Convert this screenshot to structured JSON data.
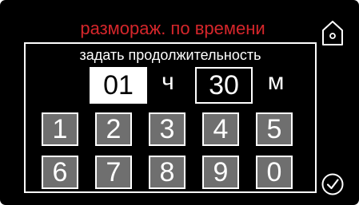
{
  "header": {
    "title": "размораж. по времени",
    "home_icon": "home-icon"
  },
  "panel": {
    "subtitle": "задать продолжительность",
    "hours_value": "01",
    "hours_unit": "ч",
    "minutes_value": "30",
    "minutes_unit": "м"
  },
  "keypad": {
    "keys": [
      "1",
      "2",
      "3",
      "4",
      "5",
      "6",
      "7",
      "8",
      "9",
      "0"
    ]
  },
  "footer": {
    "confirm_icon": "check-circle-icon"
  },
  "colors": {
    "background": "#000000",
    "title": "#d6262b",
    "key_fill": "#6f6f6f",
    "outline": "#ffffff"
  }
}
